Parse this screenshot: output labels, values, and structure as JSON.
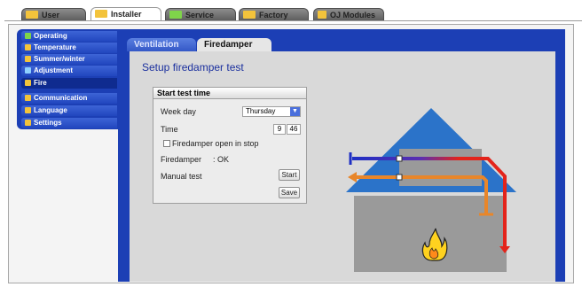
{
  "top_tabs": [
    {
      "label": "User",
      "active": false,
      "icon": "user-icon"
    },
    {
      "label": "Installer",
      "active": true,
      "icon": "installer-icon"
    },
    {
      "label": "Service",
      "active": false,
      "icon": "service-icon"
    },
    {
      "label": "Factory",
      "active": false,
      "icon": "factory-icon"
    },
    {
      "label": "OJ Modules",
      "active": false,
      "icon": "modules-icon"
    }
  ],
  "sidebar": {
    "items": [
      {
        "label": "Operating",
        "icon": "operating-icon",
        "selected": false
      },
      {
        "label": "Temperature",
        "icon": "thermometer-icon",
        "selected": false
      },
      {
        "label": "Summer/winter",
        "icon": "sun-icon",
        "selected": false
      },
      {
        "label": "Adjustment",
        "icon": "wrench-icon",
        "selected": false
      },
      {
        "label": "Fire",
        "icon": "fire-icon",
        "selected": true
      },
      {
        "label": "Communication",
        "icon": "network-icon",
        "selected": false
      },
      {
        "label": "Language",
        "icon": "flag-icon",
        "selected": false
      },
      {
        "label": "Settings",
        "icon": "folder-icon",
        "selected": false
      }
    ]
  },
  "inner_tabs": [
    {
      "label": "Ventilation",
      "active": false
    },
    {
      "label": "Firedamper",
      "active": true
    }
  ],
  "page": {
    "title": "Setup firedamper test"
  },
  "test_box": {
    "heading": "Start test time",
    "week_day_label": "Week day",
    "week_day_value": "Thursday",
    "time_label": "Time",
    "time_hour": "9",
    "time_minute": "46",
    "open_in_stop_label": "Firedamper open in stop",
    "open_in_stop_checked": false,
    "status_label": "Firedamper",
    "status_value": ": OK",
    "manual_test_label": "Manual test",
    "start_button": "Start",
    "save_button": "Save"
  },
  "colors": {
    "frame_blue": "#1c3fb5",
    "content_grey": "#d9d9d9",
    "roof_blue": "#2b73c9",
    "supply_air": "#e8862a",
    "extract_blue": "#1e2fc4",
    "extract_red": "#e3241b"
  }
}
